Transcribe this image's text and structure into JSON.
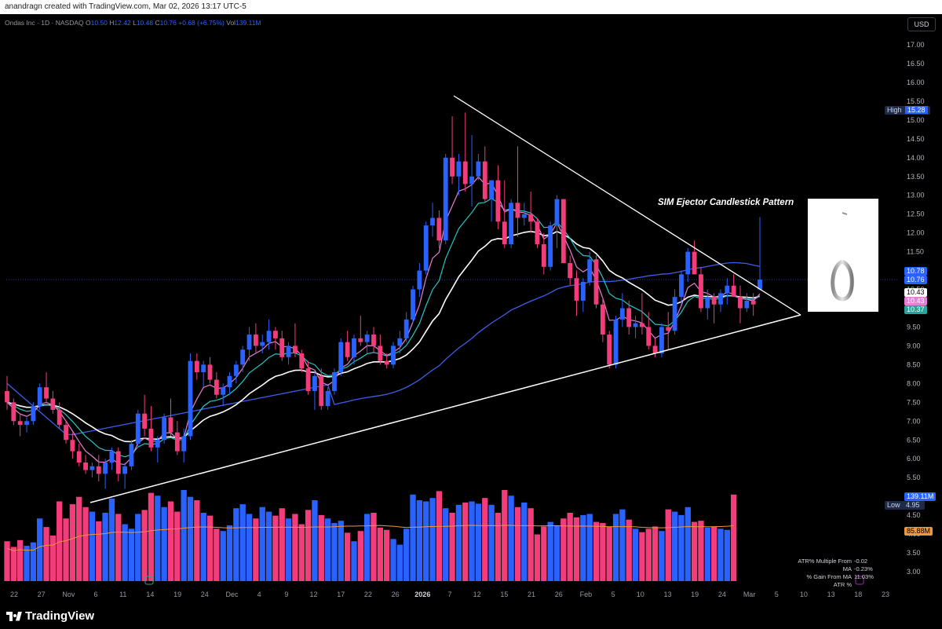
{
  "header": {
    "credit": "anandragn created with TradingView.com, Mar 02, 2026 13:17 UTC-5"
  },
  "legend": {
    "symbol": "Ondas Inc · 1D · NASDAQ",
    "o_label": "O",
    "o": "10.50",
    "h_label": "H",
    "h": "12.42",
    "l_label": "L",
    "l": "10.48",
    "c_label": "C",
    "c": "10.76",
    "change": "+0.68 (+6.75%)",
    "vol_label": "Vol",
    "vol": "139.11M"
  },
  "currency": "USD",
  "annotation": "SIM Ejector Candlestick Pattern",
  "price_tags": {
    "high_label": "High",
    "high": "15.28",
    "t1": "10.78",
    "t2": "10.76",
    "t3": "10.43",
    "t4": "10.43",
    "t5": "10.37",
    "low_label": "Low",
    "low": "4.95",
    "vol_tag": "139.11M",
    "vol_ma_tag": "85.88M"
  },
  "stats": {
    "labels": [
      "ATR% Multiple From MA",
      "% Gain From MA",
      "ATR %"
    ],
    "values": [
      "-0.02",
      "-0.23%",
      "11.03%"
    ]
  },
  "footer": {
    "brand": "TradingView"
  },
  "colors": {
    "up": "#2962ff",
    "down": "#f23d7a",
    "ma_short": "#e77fd6",
    "ma_mid": "#26c6c6",
    "ma_50": "#ffffff",
    "ma_long": "#3f5ee8",
    "vol_ma": "#f0963c"
  },
  "chart_data": {
    "type": "candlestick",
    "y_ticks": [
      "3.00",
      "3.50",
      "4.00",
      "4.50",
      "5.00",
      "5.50",
      "6.00",
      "6.50",
      "7.00",
      "7.50",
      "8.00",
      "8.50",
      "9.00",
      "9.50",
      "10.00",
      "10.50",
      "11.00",
      "11.50",
      "12.00",
      "12.50",
      "13.00",
      "13.50",
      "14.00",
      "14.50",
      "15.00",
      "15.50",
      "16.00",
      "16.50",
      "17.00"
    ],
    "x_ticks": [
      "22",
      "27",
      "Nov",
      "6",
      "11",
      "14",
      "19",
      "24",
      "Dec",
      "4",
      "9",
      "12",
      "17",
      "22",
      "26",
      "2026",
      "7",
      "12",
      "15",
      "21",
      "26",
      "Feb",
      "5",
      "10",
      "13",
      "19",
      "24",
      "Mar",
      "5",
      "10",
      "13",
      "18",
      "23"
    ],
    "candles": [
      [
        7.8,
        8.2,
        7.3,
        7.5
      ],
      [
        7.5,
        7.6,
        6.9,
        7.0
      ],
      [
        7.0,
        7.2,
        6.6,
        6.9
      ],
      [
        6.9,
        7.1,
        6.7,
        7.0
      ],
      [
        7.0,
        7.5,
        6.9,
        7.4
      ],
      [
        7.4,
        8.0,
        7.3,
        7.9
      ],
      [
        7.9,
        8.3,
        7.5,
        7.6
      ],
      [
        7.6,
        7.8,
        7.2,
        7.3
      ],
      [
        7.3,
        7.5,
        6.8,
        6.9
      ],
      [
        6.9,
        7.0,
        6.4,
        6.5
      ],
      [
        6.5,
        6.7,
        6.0,
        6.2
      ],
      [
        6.2,
        6.4,
        5.8,
        5.9
      ],
      [
        5.9,
        6.1,
        5.6,
        5.7
      ],
      [
        5.7,
        5.9,
        5.5,
        5.8
      ],
      [
        5.8,
        6.1,
        5.4,
        5.6
      ],
      [
        5.6,
        6.0,
        5.2,
        5.9
      ],
      [
        5.9,
        6.3,
        5.7,
        6.2
      ],
      [
        6.2,
        6.3,
        5.4,
        5.6
      ],
      [
        5.6,
        5.9,
        5.2,
        5.8
      ],
      [
        5.8,
        6.5,
        5.7,
        6.4
      ],
      [
        6.4,
        7.3,
        6.3,
        7.2
      ],
      [
        7.2,
        7.7,
        6.6,
        6.8
      ],
      [
        6.8,
        7.4,
        6.2,
        6.3
      ],
      [
        6.3,
        6.6,
        5.9,
        6.5
      ],
      [
        6.5,
        7.2,
        6.4,
        7.1
      ],
      [
        7.1,
        7.6,
        6.6,
        6.7
      ],
      [
        6.7,
        7.0,
        6.1,
        6.2
      ],
      [
        6.2,
        6.8,
        5.9,
        6.6
      ],
      [
        6.6,
        8.8,
        6.5,
        8.6
      ],
      [
        8.6,
        8.8,
        8.1,
        8.3
      ],
      [
        8.3,
        8.6,
        7.9,
        8.5
      ],
      [
        8.5,
        8.7,
        8.0,
        8.1
      ],
      [
        8.1,
        8.3,
        7.6,
        7.7
      ],
      [
        7.7,
        8.0,
        7.4,
        7.9
      ],
      [
        7.9,
        8.3,
        7.7,
        8.2
      ],
      [
        8.2,
        8.6,
        8.0,
        8.5
      ],
      [
        8.5,
        9.0,
        8.3,
        8.9
      ],
      [
        8.9,
        9.5,
        8.6,
        9.3
      ],
      [
        9.3,
        9.6,
        8.8,
        9.0
      ],
      [
        9.0,
        9.3,
        8.8,
        9.1
      ],
      [
        9.1,
        9.7,
        8.9,
        9.4
      ],
      [
        9.4,
        9.5,
        8.9,
        9.2
      ],
      [
        9.2,
        9.4,
        8.6,
        8.7
      ],
      [
        8.7,
        9.1,
        8.5,
        9.0
      ],
      [
        9.0,
        9.6,
        8.7,
        8.8
      ],
      [
        8.8,
        8.9,
        8.3,
        8.4
      ],
      [
        8.4,
        8.6,
        7.7,
        7.8
      ],
      [
        7.8,
        8.3,
        7.3,
        8.2
      ],
      [
        8.2,
        8.4,
        7.3,
        7.4
      ],
      [
        7.4,
        7.9,
        7.3,
        7.8
      ],
      [
        7.8,
        8.4,
        7.7,
        8.3
      ],
      [
        8.3,
        9.2,
        8.2,
        9.1
      ],
      [
        9.1,
        9.4,
        8.6,
        8.7
      ],
      [
        8.7,
        9.3,
        8.5,
        9.2
      ],
      [
        9.2,
        9.8,
        9.0,
        9.1
      ],
      [
        9.1,
        9.4,
        8.8,
        9.3
      ],
      [
        9.3,
        9.5,
        8.8,
        9.0
      ],
      [
        9.0,
        9.3,
        8.5,
        8.6
      ],
      [
        8.6,
        8.8,
        8.4,
        8.5
      ],
      [
        8.5,
        9.1,
        8.4,
        9.0
      ],
      [
        9.0,
        9.4,
        8.8,
        9.2
      ],
      [
        9.2,
        9.9,
        9.1,
        9.7
      ],
      [
        9.7,
        10.6,
        9.6,
        10.5
      ],
      [
        10.5,
        11.2,
        10.3,
        11.0
      ],
      [
        11.0,
        12.3,
        10.9,
        12.2
      ],
      [
        12.2,
        12.8,
        11.9,
        12.4
      ],
      [
        12.4,
        12.6,
        11.6,
        11.8
      ],
      [
        11.8,
        14.1,
        11.7,
        14.0
      ],
      [
        14.0,
        15.1,
        13.3,
        13.5
      ],
      [
        13.5,
        14.1,
        13.0,
        13.9
      ],
      [
        13.9,
        15.2,
        13.1,
        13.3
      ],
      [
        13.3,
        14.6,
        12.7,
        13.5
      ],
      [
        13.5,
        14.1,
        13.4,
        13.9
      ],
      [
        13.9,
        14.3,
        12.8,
        12.9
      ],
      [
        12.9,
        13.4,
        12.3,
        13.4
      ],
      [
        13.4,
        13.8,
        12.1,
        12.3
      ],
      [
        12.3,
        13.4,
        11.6,
        11.7
      ],
      [
        11.7,
        12.9,
        11.6,
        12.8
      ],
      [
        12.8,
        14.3,
        11.9,
        12.4
      ],
      [
        12.4,
        12.8,
        12.2,
        12.5
      ],
      [
        12.5,
        13.1,
        12.0,
        12.3
      ],
      [
        12.3,
        12.4,
        11.6,
        11.7
      ],
      [
        11.7,
        12.0,
        10.9,
        11.1
      ],
      [
        11.1,
        12.3,
        11.0,
        12.2
      ],
      [
        12.2,
        13.0,
        11.6,
        12.9
      ],
      [
        12.9,
        12.1,
        11.3,
        11.2
      ],
      [
        11.2,
        11.4,
        10.6,
        10.8
      ],
      [
        10.8,
        11.0,
        9.8,
        10.2
      ],
      [
        10.2,
        10.8,
        9.9,
        10.7
      ],
      [
        10.7,
        11.5,
        10.6,
        11.3
      ],
      [
        11.3,
        11.4,
        10.0,
        10.1
      ],
      [
        10.1,
        10.3,
        9.1,
        9.3
      ],
      [
        9.3,
        9.4,
        8.4,
        8.5
      ],
      [
        8.5,
        9.8,
        8.4,
        9.7
      ],
      [
        9.7,
        10.4,
        9.5,
        10.0
      ],
      [
        10.0,
        10.2,
        9.3,
        9.5
      ],
      [
        9.5,
        9.8,
        9.2,
        9.6
      ],
      [
        9.6,
        10.4,
        9.3,
        9.5
      ],
      [
        9.5,
        9.9,
        8.9,
        9.0
      ],
      [
        9.0,
        9.2,
        8.7,
        8.8
      ],
      [
        8.8,
        9.6,
        8.7,
        9.5
      ],
      [
        9.5,
        9.9,
        8.9,
        9.4
      ],
      [
        9.4,
        10.5,
        9.3,
        10.3
      ],
      [
        10.3,
        11.0,
        10.1,
        10.9
      ],
      [
        10.9,
        11.6,
        10.7,
        11.5
      ],
      [
        11.5,
        11.8,
        10.9,
        10.9
      ],
      [
        10.9,
        11.1,
        9.9,
        10.0
      ],
      [
        10.0,
        10.5,
        9.7,
        10.3
      ],
      [
        10.3,
        10.4,
        9.6,
        10.1
      ],
      [
        10.1,
        10.5,
        9.9,
        10.4
      ],
      [
        10.4,
        10.8,
        10.1,
        10.6
      ],
      [
        10.6,
        10.9,
        10.3,
        10.3
      ],
      [
        10.3,
        10.6,
        9.6,
        10.0
      ],
      [
        10.0,
        10.4,
        9.9,
        10.2
      ],
      [
        10.2,
        10.4,
        9.8,
        10.1
      ],
      [
        10.5,
        12.42,
        10.48,
        10.76
      ]
    ],
    "volume_M": [
      70,
      60,
      72,
      62,
      68,
      110,
      95,
      80,
      140,
      110,
      135,
      148,
      130,
      122,
      105,
      120,
      145,
      118,
      100,
      92,
      118,
      125,
      155,
      150,
      130,
      140,
      122,
      160,
      148,
      142,
      120,
      115,
      92,
      88,
      98,
      128,
      135,
      118,
      110,
      130,
      122,
      115,
      128,
      110,
      118,
      100,
      125,
      142,
      116,
      110,
      102,
      106,
      85,
      70,
      88,
      118,
      120,
      94,
      90,
      74,
      64,
      92,
      152,
      142,
      140,
      146,
      158,
      128,
      120,
      134,
      138,
      140,
      136,
      146,
      134,
      120,
      160,
      150,
      130,
      138,
      128,
      82,
      96,
      104,
      98,
      110,
      120,
      112,
      116,
      118,
      104,
      102,
      96,
      118,
      126,
      108,
      92,
      86,
      92,
      96,
      88,
      126,
      122,
      116,
      130,
      104,
      106,
      94,
      96,
      92,
      90,
      152
    ],
    "ylim": [
      2.9,
      17.4
    ],
    "volume_ma_tag": "85.88M"
  }
}
